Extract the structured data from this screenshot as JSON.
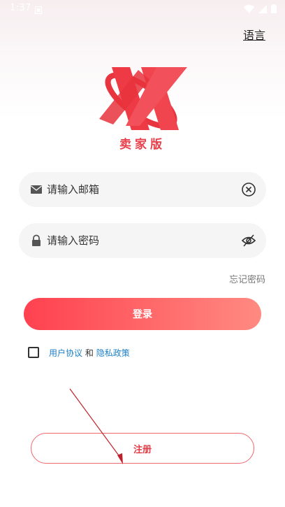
{
  "status_bar": {
    "time": "1:37",
    "icons": [
      "notification-icon",
      "wifi-icon",
      "signal-icon",
      "battery-icon"
    ]
  },
  "header": {
    "language_label": "语言"
  },
  "logo": {
    "subtitle": "卖家版",
    "brand_color": "#e8404a"
  },
  "form": {
    "email": {
      "placeholder": "请输入邮箱",
      "value": "",
      "icon": "mail-icon",
      "action_icon": "clear-icon"
    },
    "password": {
      "placeholder": "请输入密码",
      "value": "",
      "icon": "lock-icon",
      "action_icon": "eye-off-icon"
    },
    "forgot_label": "忘记密码",
    "login_label": "登录"
  },
  "agreement": {
    "user_agreement": "用户协议",
    "and": "和",
    "privacy_policy": "隐私政策",
    "checked": false
  },
  "register_label": "注册",
  "colors": {
    "primary": "#ff4150",
    "link": "#1e80c8",
    "annotation": "#c0202a"
  }
}
